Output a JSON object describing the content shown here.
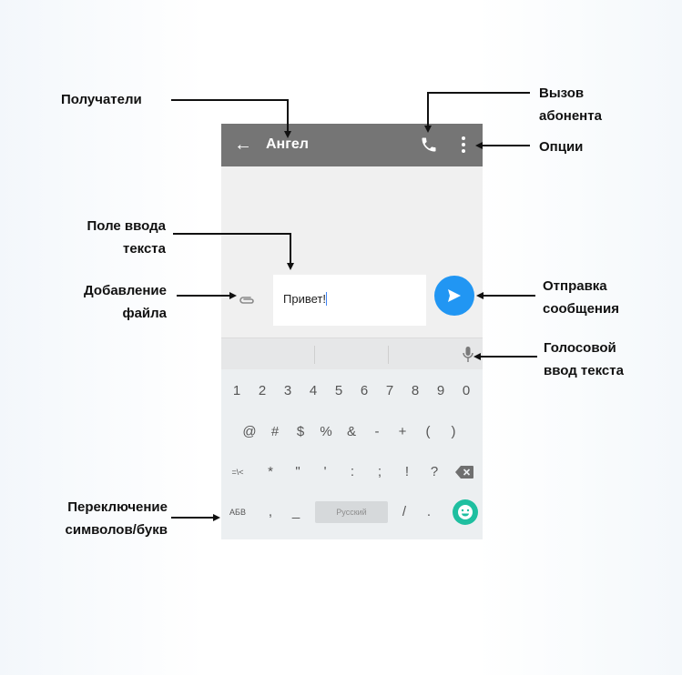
{
  "annotations": {
    "recipients": "Получатели",
    "call": [
      "Вызов",
      "абонента"
    ],
    "options": "Опции",
    "input_field": [
      "Поле ввода",
      "текста"
    ],
    "attach": [
      "Добавление",
      "файла"
    ],
    "send": [
      "Отправка",
      "сообщения"
    ],
    "voice": [
      "Голосовой",
      "ввод текста"
    ],
    "switch": [
      "Переключение",
      "символов/букв"
    ]
  },
  "app_bar": {
    "back_icon": "arrow-left-icon",
    "title": "Ангел",
    "call_icon": "phone-icon",
    "menu_icon": "more-vert-icon",
    "color": "#757575"
  },
  "compose": {
    "attach_icon": "paperclip-icon",
    "value": "Привет!",
    "send_icon": "send-icon",
    "send_color": "#2196f3"
  },
  "keyboard": {
    "mic_icon": "microphone-icon",
    "row1": [
      "1",
      "2",
      "3",
      "4",
      "5",
      "6",
      "7",
      "8",
      "9",
      "0"
    ],
    "row2": [
      "@",
      "#",
      "$",
      "%",
      "&",
      "-",
      "+",
      "(",
      ")"
    ],
    "row3": [
      "=\\<",
      "*",
      "\"",
      "'",
      ":",
      ";",
      "!",
      "?"
    ],
    "backspace_icon": "backspace-icon",
    "row4": [
      "АБВ",
      ",",
      "_",
      "/",
      "."
    ],
    "space_label": "Русский",
    "emoji_icon": "emoji-icon",
    "emoji_color": "#1fbfa0"
  }
}
